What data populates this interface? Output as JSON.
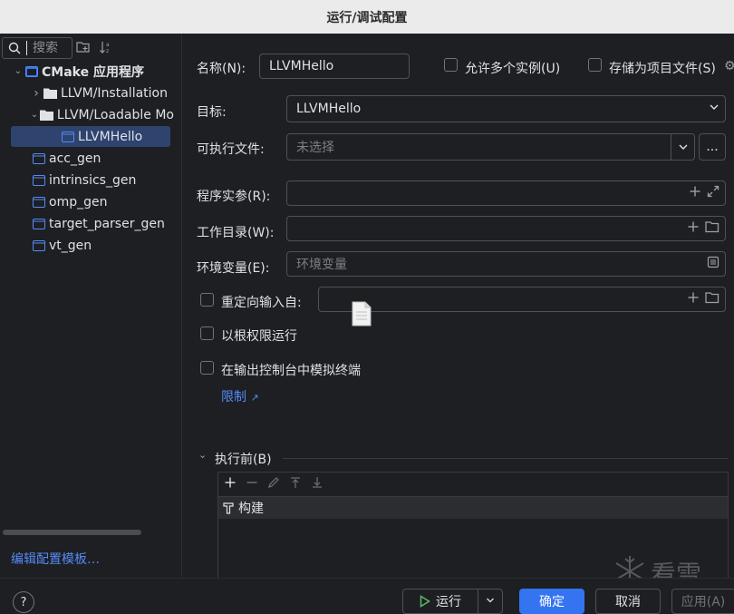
{
  "window": {
    "title": "运行/调试配置"
  },
  "sidebar": {
    "search_placeholder": "搜索",
    "tree": [
      {
        "label": "CMake 应用程序",
        "level": 0,
        "expanded": true,
        "bold": true,
        "icon": "cmake-config-icon"
      },
      {
        "label": "LLVM/Installation",
        "level": 1,
        "expanded": false,
        "icon": "folder-icon"
      },
      {
        "label": "LLVM/Loadable Mo",
        "level": 1,
        "expanded": true,
        "icon": "folder-icon"
      },
      {
        "label": "LLVMHello",
        "level": 2,
        "selected": true,
        "icon": "config-icon"
      },
      {
        "label": "acc_gen",
        "level": 1,
        "icon": "config-icon"
      },
      {
        "label": "intrinsics_gen",
        "level": 1,
        "icon": "config-icon"
      },
      {
        "label": "omp_gen",
        "level": 1,
        "icon": "config-icon"
      },
      {
        "label": "target_parser_gen",
        "level": 1,
        "icon": "config-icon"
      },
      {
        "label": "vt_gen",
        "level": 1,
        "icon": "config-icon"
      }
    ],
    "edit_templates_link": "编辑配置模板…"
  },
  "form": {
    "name_label": "名称(N):",
    "name_value": "LLVMHello",
    "allow_multiple_label": "允许多个实例(U)",
    "store_as_file_label": "存储为项目文件(S)",
    "target_label": "目标:",
    "target_value": "LLVMHello",
    "executable_label": "可执行文件:",
    "executable_placeholder": "未选择",
    "executable_more": "...",
    "program_args_label": "程序实参(R):",
    "working_dir_label": "工作目录(W):",
    "env_label": "环境变量(E):",
    "env_placeholder": "环境变量",
    "redirect_label": "重定向输入自:",
    "run_as_root_label": "以根权限运行",
    "emulate_terminal_label": "在输出控制台中模拟终端",
    "limit_link": "限制",
    "before_launch_label": "执行前(B)",
    "before_launch_items": [
      "构建"
    ]
  },
  "footer": {
    "help_label": "?",
    "run_label": "运行",
    "ok_label": "确定",
    "cancel_label": "取消",
    "apply_label": "应用(A)"
  },
  "watermark": {
    "text": "看雪"
  },
  "colors": {
    "accent": "#3574f0",
    "link": "#548af7",
    "selected": "#2e436e",
    "background": "#1e1f22"
  }
}
